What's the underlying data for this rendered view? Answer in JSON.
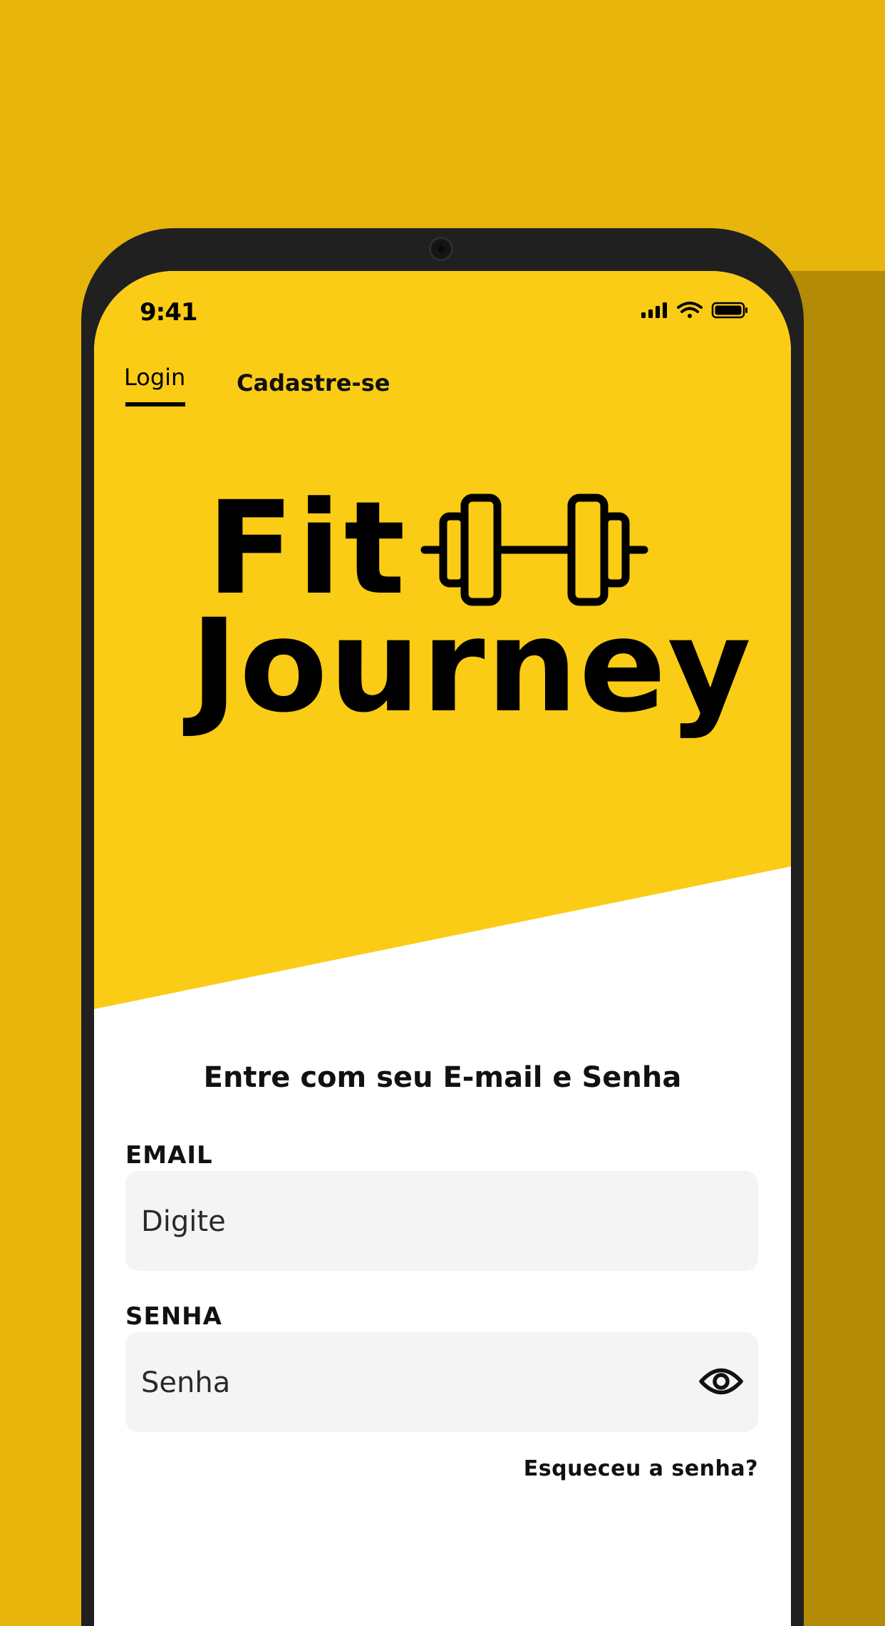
{
  "status_bar": {
    "time": "9:41"
  },
  "tabs": {
    "login": "Login",
    "signup": "Cadastre-se"
  },
  "logo": {
    "line1": "Fit",
    "line2": "Journey",
    "icon": "dumbbell-icon"
  },
  "form": {
    "heading": "Entre com seu E-mail e Senha",
    "email": {
      "label": "EMAIL",
      "placeholder": "Digite",
      "value": ""
    },
    "password": {
      "label": "SENHA",
      "placeholder": "Senha",
      "value": "",
      "toggle_icon": "eye-icon"
    },
    "forgot_link": "Esqueceu a senha?"
  },
  "colors": {
    "background": "#E8B50C",
    "accent": "#FACC15",
    "frame": "#202020",
    "field": "#F4F4F4"
  }
}
